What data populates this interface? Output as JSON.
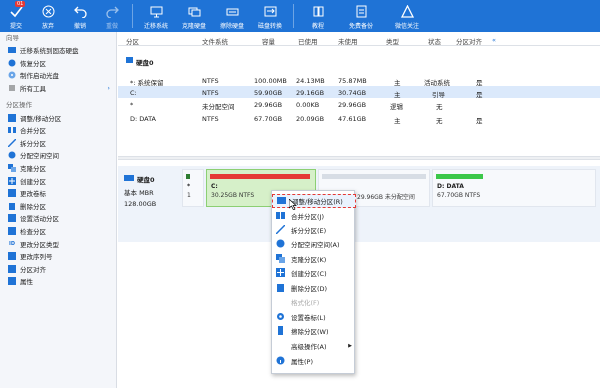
{
  "toolbar": {
    "commit": "提交",
    "commit_badge": "01",
    "discard": "放弃",
    "undo": "撤销",
    "redo": "重做",
    "migrate_os": "迁移系统",
    "clone_disk": "克隆硬盘",
    "wipe_disk": "擦除硬盘",
    "disk_convert": "磁盘转换",
    "tutorial": "教程",
    "free_backup": "免费备份",
    "wechat_follow": "微信关注"
  },
  "sidebar": {
    "guide_title": "向导",
    "guide_items": [
      "迁移系统到固态硬盘",
      "恢复分区",
      "制作启动光盘",
      "所有工具"
    ],
    "ops_title": "分区操作",
    "op_items": [
      "调整/移动分区",
      "合并分区",
      "拆分分区",
      "分配空闲空间",
      "克隆分区",
      "创建分区",
      "更改卷标",
      "删除分区",
      "设置活动分区",
      "检查分区",
      "更改分区类型",
      "更改序列号",
      "分区对齐",
      "属性"
    ]
  },
  "table": {
    "headers": [
      "分区",
      "文件系统",
      "容量",
      "已使用",
      "未使用",
      "类型",
      "状态",
      "分区对齐"
    ],
    "disk_label": "硬盘0",
    "rows": [
      [
        "*: 系统保留",
        "NTFS",
        "100.00MB",
        "24.13MB",
        "75.87MB",
        "主",
        "活动系统",
        "是"
      ],
      [
        "C:",
        "NTFS",
        "59.90GB",
        "29.16GB",
        "30.74GB",
        "主",
        "引导",
        "是"
      ],
      [
        "*",
        "未分配空间",
        "29.96GB",
        "0.00KB",
        "29.96GB",
        "逻辑",
        "无",
        ""
      ],
      [
        "D: DATA",
        "NTFS",
        "67.70GB",
        "20.09GB",
        "47.61GB",
        "主",
        "无",
        "是"
      ]
    ]
  },
  "diskmap": {
    "disk_name": "硬盘0",
    "disk_type": "基本 MBR",
    "disk_size": "128.00GB",
    "parts": [
      {
        "name": "*",
        "info": "1",
        "color": "#2e7d32",
        "fill": 0.24
      },
      {
        "name": "C:",
        "info": "30.25GB NTFS",
        "color": "#e53935",
        "fill": 0.98
      },
      {
        "name": "",
        "info": "29.96GB 未分配空间",
        "color": "#d7dde5",
        "fill": 1
      },
      {
        "name": "D: DATA",
        "info": "67.70GB NTFS",
        "color": "#3cc84a",
        "fill": 0.3
      }
    ]
  },
  "context_menu": [
    "调整/移动分区(R)",
    "合并分区(J)",
    "拆分分区(E)",
    "分配空闲空间(A)",
    "克隆分区(K)",
    "创建分区(C)",
    "删除分区(D)",
    "格式化(F)",
    "设置卷标(L)",
    "擦除分区(W)",
    "高级操作(A)",
    "属性(P)"
  ]
}
